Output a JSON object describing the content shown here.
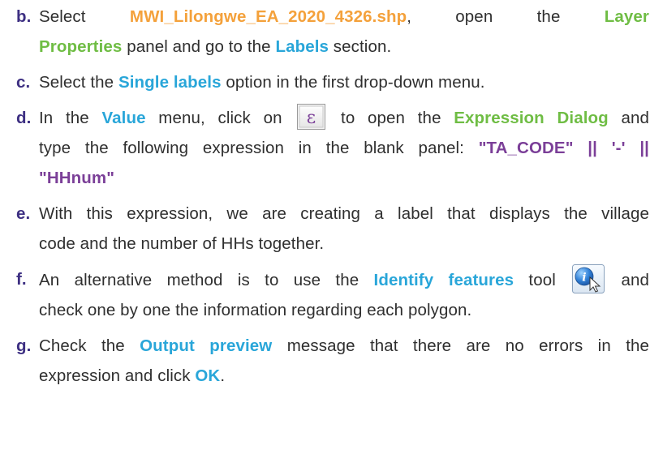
{
  "steps": [
    {
      "marker": "b.",
      "line1": {
        "t1": "Select ",
        "file": "MWI_Lilongwe_EA_2020_4326.shp",
        "t2": ", open the ",
        "layer": "Layer"
      },
      "line2": {
        "properties": "Properties",
        "t3": " panel and go to the ",
        "labels": "Labels",
        "t4": " section."
      }
    },
    {
      "marker": "c.",
      "t1": "Select the ",
      "single": "Single labels",
      "t2": " option in the first drop-down menu."
    },
    {
      "marker": "d.",
      "line1": {
        "t1": "In the ",
        "value": "Value",
        "t2": " menu, click on ",
        "icon": "expression-epsilon-icon",
        "t3": " to open the ",
        "dialog": "Expression Dialog",
        "t4": " and"
      },
      "line2": {
        "t5": "type the following expression in the blank panel: ",
        "expr_a": "\"TA_CODE\" || '-' ||"
      },
      "line3": {
        "expr_b": "\"HHnum\""
      }
    },
    {
      "marker": "e.",
      "line1": "With this expression, we are creating a label that displays the village",
      "line2": "code and the number of HHs together."
    },
    {
      "marker": "f.",
      "line1": {
        "t1": "An alternative method is to use the ",
        "tool": "Identify features",
        "t2": " tool ",
        "icon": "identify-features-icon",
        "t3": " and"
      },
      "line2": "check one by one the information regarding each polygon."
    },
    {
      "marker": "g.",
      "line1": {
        "t1": "Check the ",
        "preview": "Output preview",
        "t2": " message that there are no errors in the"
      },
      "line2": {
        "t3": "expression and click ",
        "ok": "OK",
        "t4": "."
      }
    }
  ],
  "colors": {
    "marker": "#3d2f82",
    "green": "#6fbd44",
    "orange": "#f4a13b",
    "blue": "#29a6d9",
    "purple": "#7b3f98",
    "text": "#2f2f2f"
  }
}
